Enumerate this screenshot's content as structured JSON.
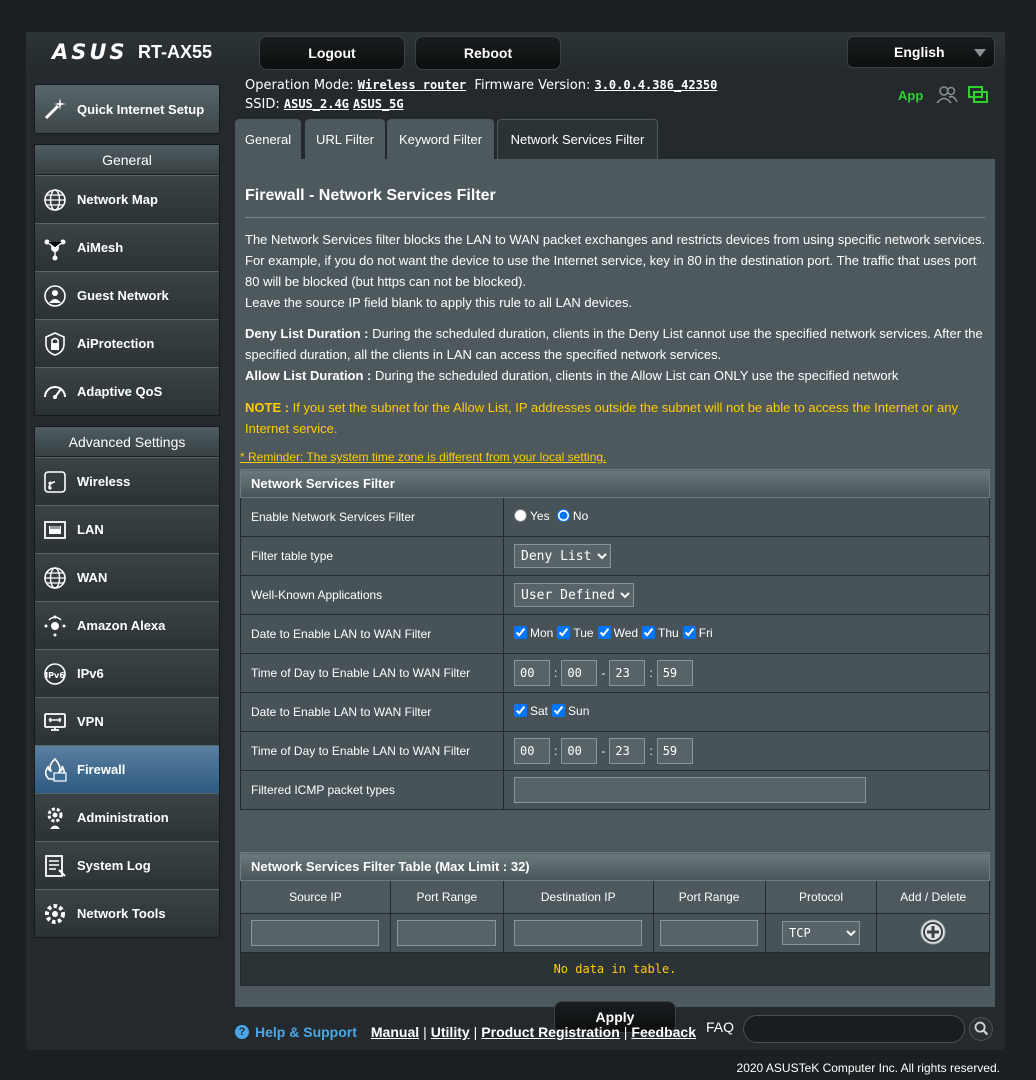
{
  "header": {
    "logo": "ASUS",
    "model": "RT-AX55",
    "logout_label": "Logout",
    "reboot_label": "Reboot",
    "language": "English"
  },
  "info": {
    "op_mode_label": "Operation Mode:",
    "op_mode_value": "Wireless router",
    "firmware_label": "Firmware Version:",
    "firmware_value": "3.0.0.4.386_42350",
    "ssid_label": "SSID:",
    "ssid_24": "ASUS_2.4G",
    "ssid_5": "ASUS_5G",
    "app_label": "App"
  },
  "sidebar": {
    "quick_setup": "Quick Internet Setup",
    "general_header": "General",
    "general_items": [
      {
        "label": "Network Map",
        "icon": "globe-icon"
      },
      {
        "label": "AiMesh",
        "icon": "aimesh-icon"
      },
      {
        "label": "Guest Network",
        "icon": "guest-network-icon"
      },
      {
        "label": "AiProtection",
        "icon": "lock-shield-icon"
      },
      {
        "label": "Adaptive QoS",
        "icon": "speedometer-icon"
      }
    ],
    "advanced_header": "Advanced Settings",
    "advanced_items": [
      {
        "label": "Wireless",
        "icon": "wifi-icon"
      },
      {
        "label": "LAN",
        "icon": "lan-port-icon"
      },
      {
        "label": "WAN",
        "icon": "globe-icon"
      },
      {
        "label": "Amazon Alexa",
        "icon": "alexa-icon"
      },
      {
        "label": "IPv6",
        "icon": "ipv6-icon"
      },
      {
        "label": "VPN",
        "icon": "vpn-icon"
      },
      {
        "label": "Firewall",
        "icon": "firewall-icon",
        "active": true
      },
      {
        "label": "Administration",
        "icon": "gear-user-icon"
      },
      {
        "label": "System Log",
        "icon": "system-log-icon"
      },
      {
        "label": "Network Tools",
        "icon": "gear-icon"
      }
    ]
  },
  "tabs": [
    "General",
    "URL Filter",
    "Keyword Filter",
    "Network Services Filter"
  ],
  "main": {
    "title": "Firewall - Network Services Filter",
    "desc1": "The Network Services filter blocks the LAN to WAN packet exchanges and restricts devices from using specific network services.",
    "desc2": "For example, if you do not want the device to use the Internet service, key in 80 in the destination port. The traffic that uses port 80 will be blocked (but https can not be blocked).",
    "desc3": "Leave the source IP field blank to apply this rule to all LAN devices.",
    "deny_label": "Deny List Duration :",
    "deny_text": " During the scheduled duration, clients in the Deny List cannot use the specified network services. After the specified duration, all the clients in LAN can access the specified network services.",
    "allow_label": "Allow List Duration :",
    "allow_text": " During the scheduled duration, clients in the Allow List can ONLY use the specified network",
    "note_label": "NOTE :",
    "note_text": " If you set the subnet for the Allow List, IP addresses outside the subnet will not be able to access the Internet or any Internet service.",
    "reminder": "* Reminder: The system time zone is different from your local setting."
  },
  "filter": {
    "header": "Network Services Filter",
    "enable_label": "Enable Network Services Filter",
    "yes": "Yes",
    "no": "No",
    "table_type_label": "Filter table type",
    "table_type_value": "Deny List",
    "apps_label": "Well-Known Applications",
    "apps_value": "User Defined",
    "weekday_label": "Date to Enable LAN to WAN Filter",
    "weekdays": [
      "Mon",
      "Tue",
      "Wed",
      "Thu",
      "Fri"
    ],
    "weekday_time_label": "Time of Day to Enable LAN to WAN Filter",
    "weekday_time": [
      "00",
      "00",
      "23",
      "59"
    ],
    "weekend_label": "Date to Enable LAN to WAN Filter",
    "weekend": [
      "Sat",
      "Sun"
    ],
    "weekend_time_label": "Time of Day to Enable LAN to WAN Filter",
    "weekend_time": [
      "00",
      "00",
      "23",
      "59"
    ],
    "icmp_label": "Filtered ICMP packet types"
  },
  "rules_table": {
    "header": "Network Services Filter Table (Max Limit : 32)",
    "columns": [
      "Source IP",
      "Port Range",
      "Destination IP",
      "Port Range",
      "Protocol",
      "Add / Delete"
    ],
    "protocol_value": "TCP",
    "empty_text": "No data in table."
  },
  "apply_label": "Apply",
  "footer": {
    "help": "Help & Support",
    "links": [
      "Manual",
      "Utility",
      "Product Registration",
      "Feedback"
    ],
    "faq": "FAQ",
    "copyright": "2020 ASUSTeK Computer Inc. All rights reserved."
  }
}
